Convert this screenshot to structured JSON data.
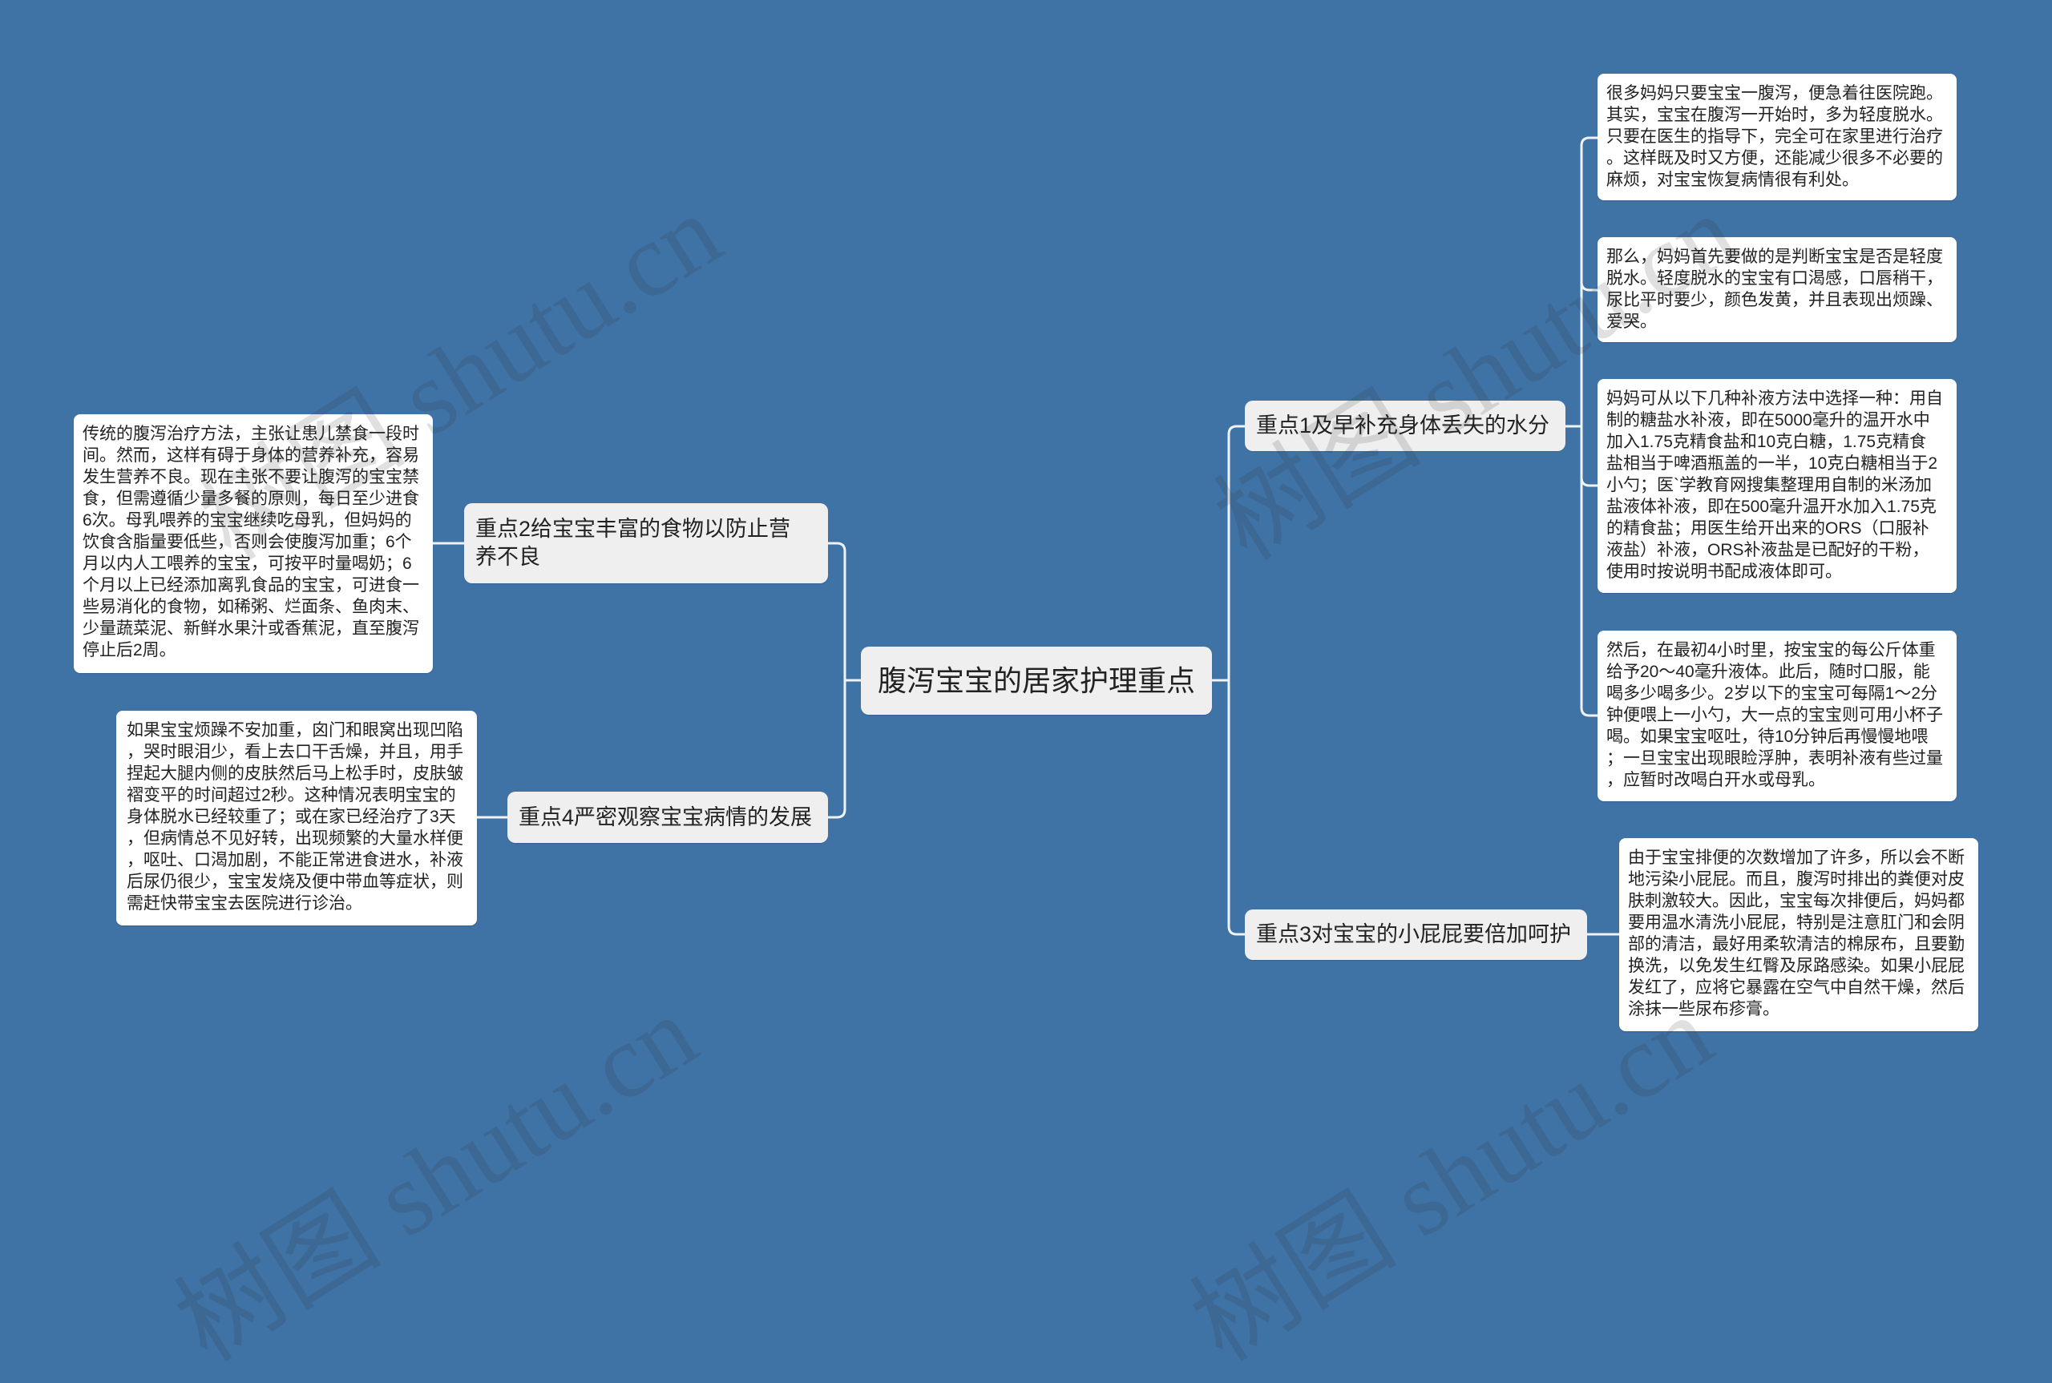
{
  "colors": {
    "background": "#3f72a5",
    "node_fill": "#efefef",
    "detail_fill": "#ffffff",
    "connector": "#eef3f8",
    "text": "#222222"
  },
  "watermark": "树图 shutu.cn",
  "root": {
    "label": "腹泻宝宝的居家护理重点"
  },
  "right_branches": [
    {
      "label": "重点1及早补充身体丢失的水分",
      "details": [
        "很多妈妈只要宝宝一腹泻，便急着往医院跑。\n其实，宝宝在腹泻一开始时，多为轻度脱水。\n只要在医生的指导下，完全可在家里进行治疗\n。这样既及时又方便，还能减少很多不必要的\n麻烦，对宝宝恢复病情很有利处。",
        "那么，妈妈首先要做的是判断宝宝是否是轻度\n脱水。轻度脱水的宝宝有口渴感，口唇稍干，\n尿比平时要少，颜色发黄，并且表现出烦躁、\n爱哭。",
        "妈妈可从以下几种补液方法中选择一种：用自\n制的糖盐水补液，即在5000毫升的温开水中\n加入1.75克精食盐和10克白糖，1.75克精食\n盐相当于啤酒瓶盖的一半，10克白糖相当于2\n小勺；医`学教育网搜集整理用自制的米汤加\n盐液体补液，即在500毫升温开水加入1.75克\n的精食盐；用医生给开出来的ORS（口服补\n液盐）补液，ORS补液盐是已配好的干粉，\n使用时按说明书配成液体即可。",
        "然后，在最初4小时里，按宝宝的每公斤体重\n给予20～40毫升液体。此后，随时口服，能\n喝多少喝多少。2岁以下的宝宝可每隔1～2分\n钟便喂上一小勺，大一点的宝宝则可用小杯子\n喝。如果宝宝呕吐，待10分钟后再慢慢地喂\n；一旦宝宝出现眼睑浮肿，表明补液有些过量\n，应暂时改喝白开水或母乳。"
      ]
    },
    {
      "label": "重点3对宝宝的小屁屁要倍加呵护",
      "details": [
        "由于宝宝排便的次数增加了许多，所以会不断\n地污染小屁屁。而且，腹泻时排出的粪便对皮\n肤刺激较大。因此，宝宝每次排便后，妈妈都\n要用温水清洗小屁屁，特别是注意肛门和会阴\n部的清洁，最好用柔软清洁的棉尿布，且要勤\n换洗，以免发生红臀及尿路感染。如果小屁屁\n发红了，应将它暴露在空气中自然干燥，然后\n涂抹一些尿布疹膏。"
      ]
    }
  ],
  "left_branches": [
    {
      "label": "重点2给宝宝丰富的食物以防止营\n养不良",
      "details": [
        "传统的腹泻治疗方法，主张让患儿禁食一段时\n间。然而，这样有碍于身体的营养补充，容易\n发生营养不良。现在主张不要让腹泻的宝宝禁\n食，但需遵循少量多餐的原则，每日至少进食\n6次。母乳喂养的宝宝继续吃母乳，但妈妈的\n饮食含脂量要低些，否则会使腹泻加重；6个\n月以内人工喂养的宝宝，可按平时量喝奶；6\n个月以上已经添加离乳食品的宝宝，可进食一\n些易消化的食物，如稀粥、烂面条、鱼肉末、\n少量蔬菜泥、新鲜水果汁或香蕉泥，直至腹泻\n停止后2周。"
      ]
    },
    {
      "label": "重点4严密观察宝宝病情的发展",
      "details": [
        "如果宝宝烦躁不安加重，囟门和眼窝出现凹陷\n，哭时眼泪少，看上去口干舌燥，并且，用手\n捏起大腿内侧的皮肤然后马上松手时，皮肤皱\n褶变平的时间超过2秒。这种情况表明宝宝的\n身体脱水已经较重了；或在家已经治疗了3天\n，但病情总不见好转，出现频繁的大量水样便\n，呕吐、口渴加剧，不能正常进食进水，补液\n后尿仍很少，宝宝发烧及便中带血等症状，则\n需赶快带宝宝去医院进行诊治。"
      ]
    }
  ]
}
